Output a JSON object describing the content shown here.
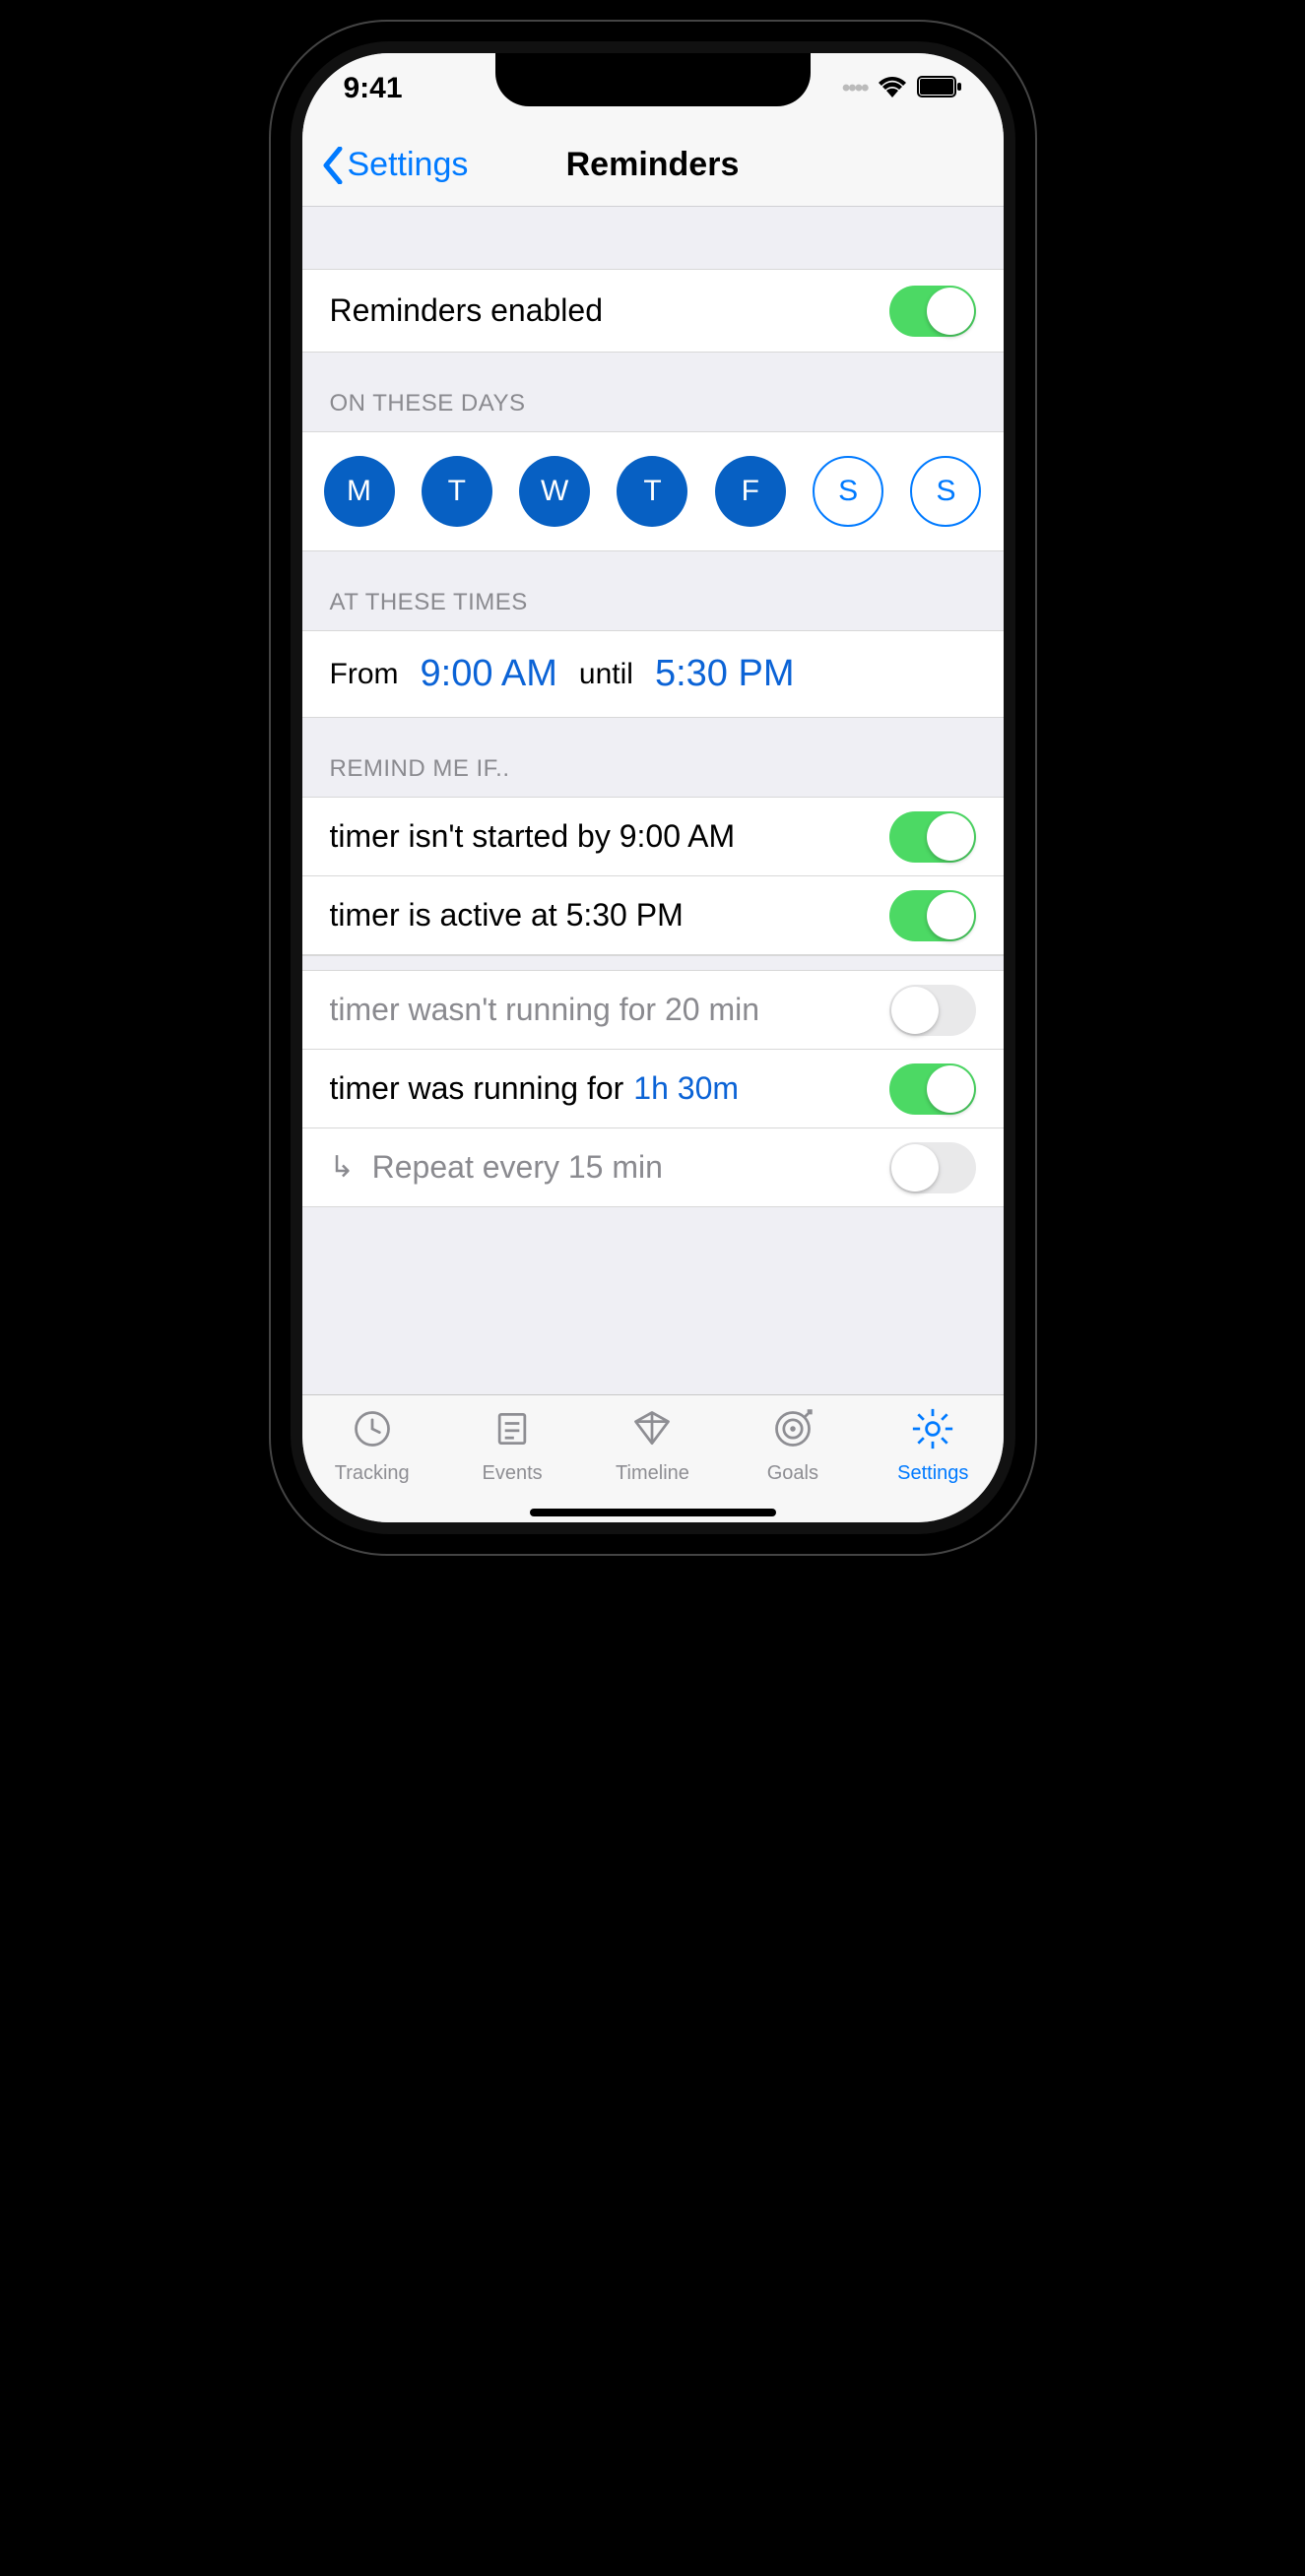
{
  "status": {
    "time": "9:41"
  },
  "nav": {
    "back_label": "Settings",
    "title": "Reminders"
  },
  "enable_row": {
    "label": "Reminders enabled",
    "on": true
  },
  "days": {
    "header": "ON THESE DAYS",
    "items": [
      {
        "letter": "M",
        "on": true
      },
      {
        "letter": "T",
        "on": true
      },
      {
        "letter": "W",
        "on": true
      },
      {
        "letter": "T",
        "on": true
      },
      {
        "letter": "F",
        "on": true
      },
      {
        "letter": "S",
        "on": false
      },
      {
        "letter": "S",
        "on": false
      }
    ]
  },
  "times": {
    "header": "AT THESE TIMES",
    "from_label": "From",
    "from_value": "9:00 AM",
    "until_label": "until",
    "until_value": "5:30 PM"
  },
  "remind": {
    "header": "REMIND ME IF..",
    "r1": {
      "label": "timer isn't started by 9:00 AM",
      "on": true
    },
    "r2": {
      "label": "timer is active at 5:30 PM",
      "on": true
    },
    "r3": {
      "label": "timer wasn't running for 20 min",
      "on": false
    },
    "r4": {
      "label_prefix": "timer was running for",
      "value": "1h 30m",
      "on": true
    },
    "r5": {
      "label": "Repeat every 15 min",
      "on": false
    }
  },
  "tabs": {
    "tracking": "Tracking",
    "events": "Events",
    "timeline": "Timeline",
    "goals": "Goals",
    "settings": "Settings"
  }
}
